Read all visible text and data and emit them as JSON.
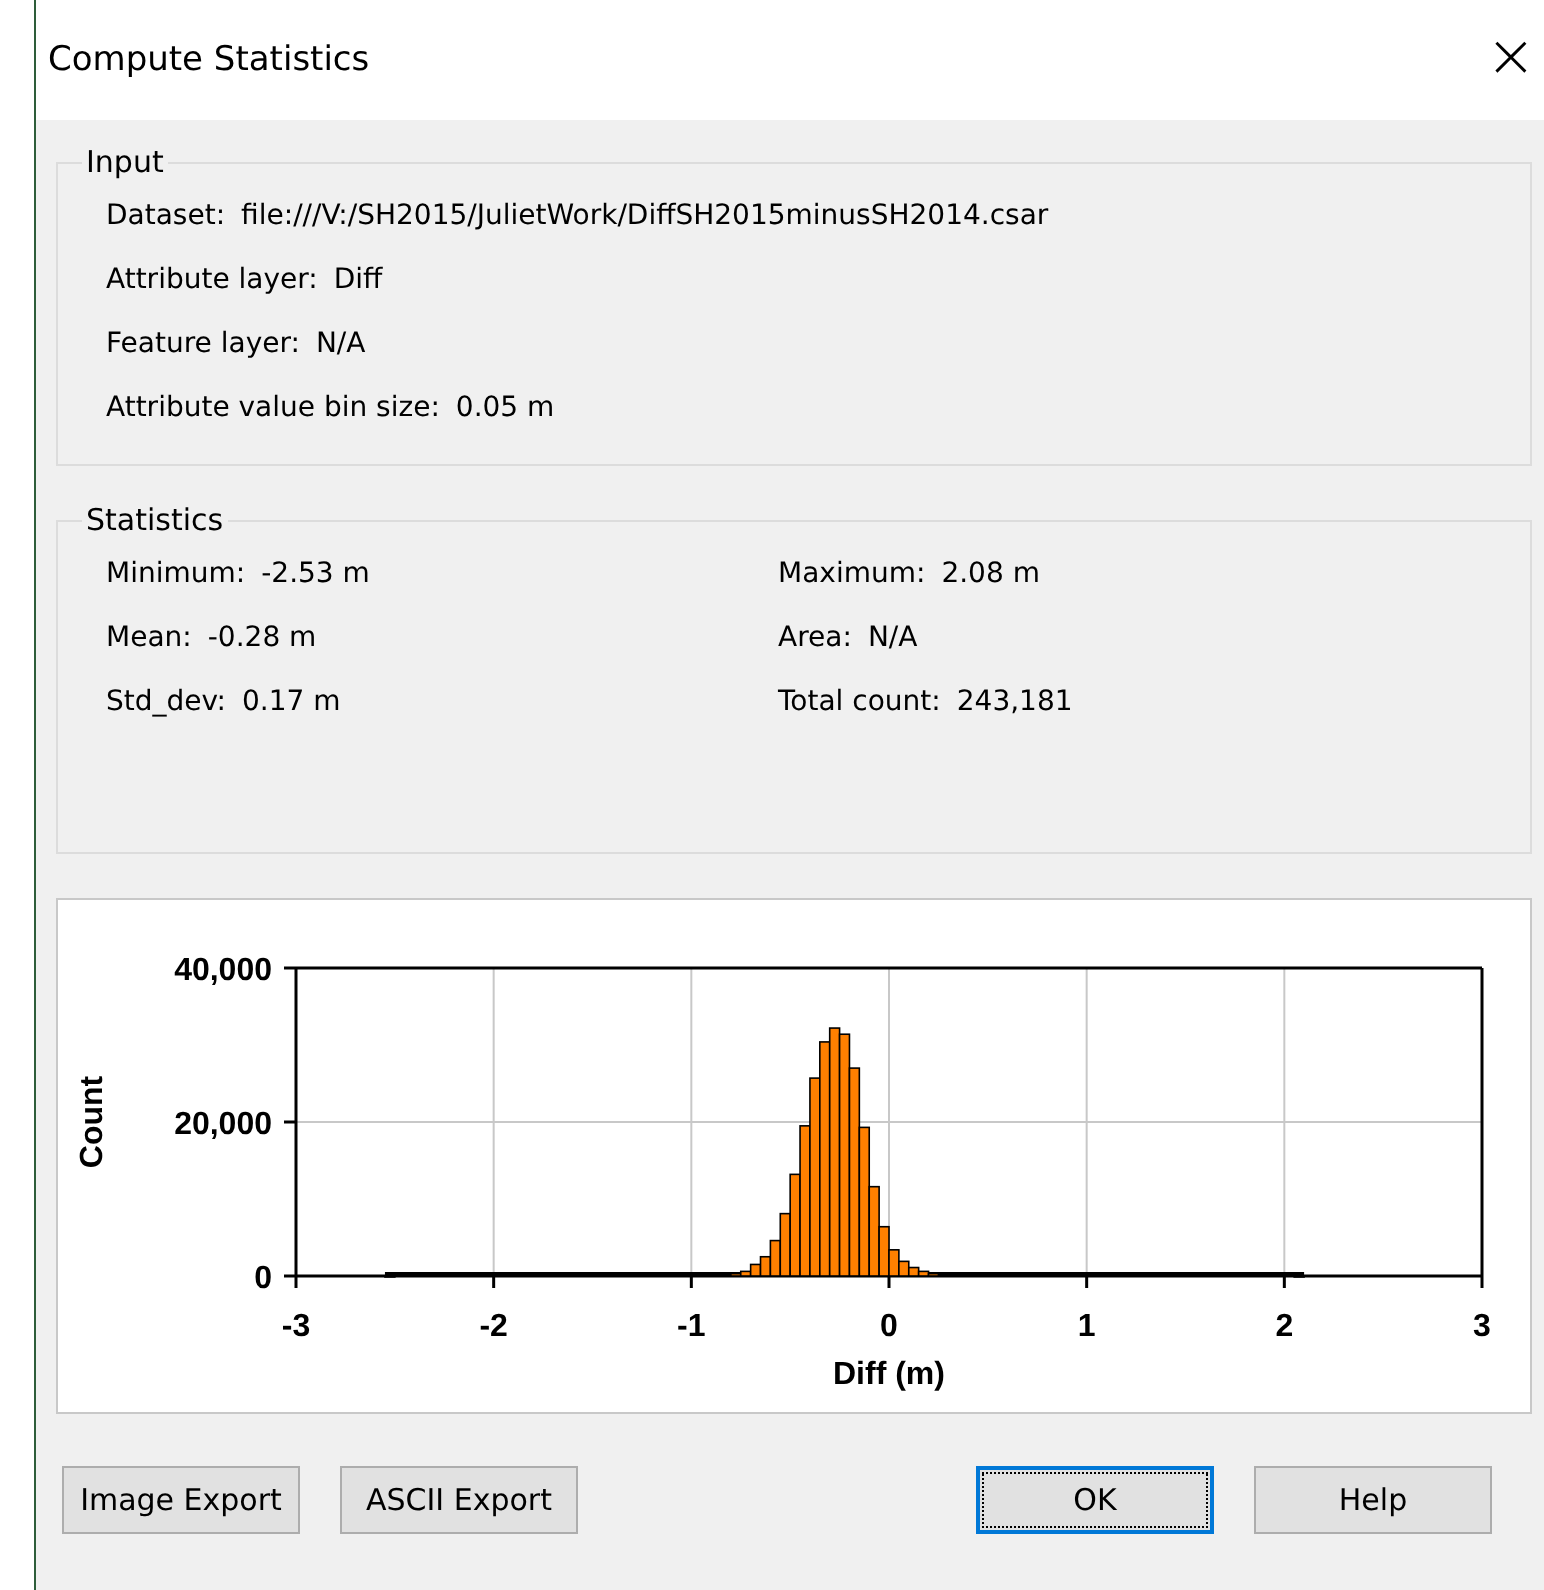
{
  "window": {
    "title": "Compute Statistics",
    "close": "×"
  },
  "input": {
    "title": "Input",
    "fields": [
      {
        "label": "Dataset:",
        "value": "file:///V:/SH2015/JulietWork/DiffSH2015minusSH2014.csar"
      },
      {
        "label": "Attribute layer:",
        "value": "Diff"
      },
      {
        "label": "Feature layer:",
        "value": "N/A"
      },
      {
        "label": "Attribute value bin size:",
        "value": "0.05 m"
      }
    ]
  },
  "statistics": {
    "title": "Statistics",
    "fields": [
      {
        "label": "Minimum:",
        "value": "-2.53 m"
      },
      {
        "label": "Maximum:",
        "value": "2.08 m"
      },
      {
        "label": "Mean:",
        "value": "-0.28 m"
      },
      {
        "label": "Area:",
        "value": "N/A"
      },
      {
        "label": "Std_dev:",
        "value": "0.17 m"
      },
      {
        "label": "Total count:",
        "value": "243,181"
      }
    ]
  },
  "chart": {
    "chart_data": {
      "type": "bar",
      "xlabel": "Diff (m)",
      "ylabel": "Count",
      "x": [
        -2.55,
        -0.8,
        -0.75,
        -0.7,
        -0.65,
        -0.6,
        -0.55,
        -0.5,
        -0.45,
        -0.4,
        -0.35,
        -0.3,
        -0.25,
        -0.2,
        -0.15,
        -0.1,
        -0.05,
        0,
        0.05,
        0.1,
        0.15,
        0.2,
        2.05
      ],
      "grid": true,
      "series": [
        {
          "color": "#ff8000",
          "values": [
            0,
            300,
            600,
            1500,
            2500,
            4600,
            8100,
            13200,
            19500,
            25700,
            30400,
            32200,
            31400,
            27000,
            19300,
            11600,
            6400,
            3400,
            1900,
            1100,
            600,
            300,
            0
          ]
        }
      ],
      "xlim": [
        -3,
        3
      ],
      "ylim": [
        0,
        40000
      ],
      "xticks": [
        -3,
        -2,
        -1,
        0,
        1,
        2,
        3
      ],
      "yticks": [
        0,
        {
          "value": 20000,
          "label": "20,000"
        },
        {
          "value": 40000,
          "label": "40,000"
        }
      ]
    }
  },
  "buttons": [
    {
      "label": "Image Export",
      "selected": false
    },
    {
      "label": "ASCII Export",
      "selected": false
    },
    {
      "label": "OK",
      "selected": true
    },
    {
      "label": "Help",
      "selected": false
    }
  ]
}
